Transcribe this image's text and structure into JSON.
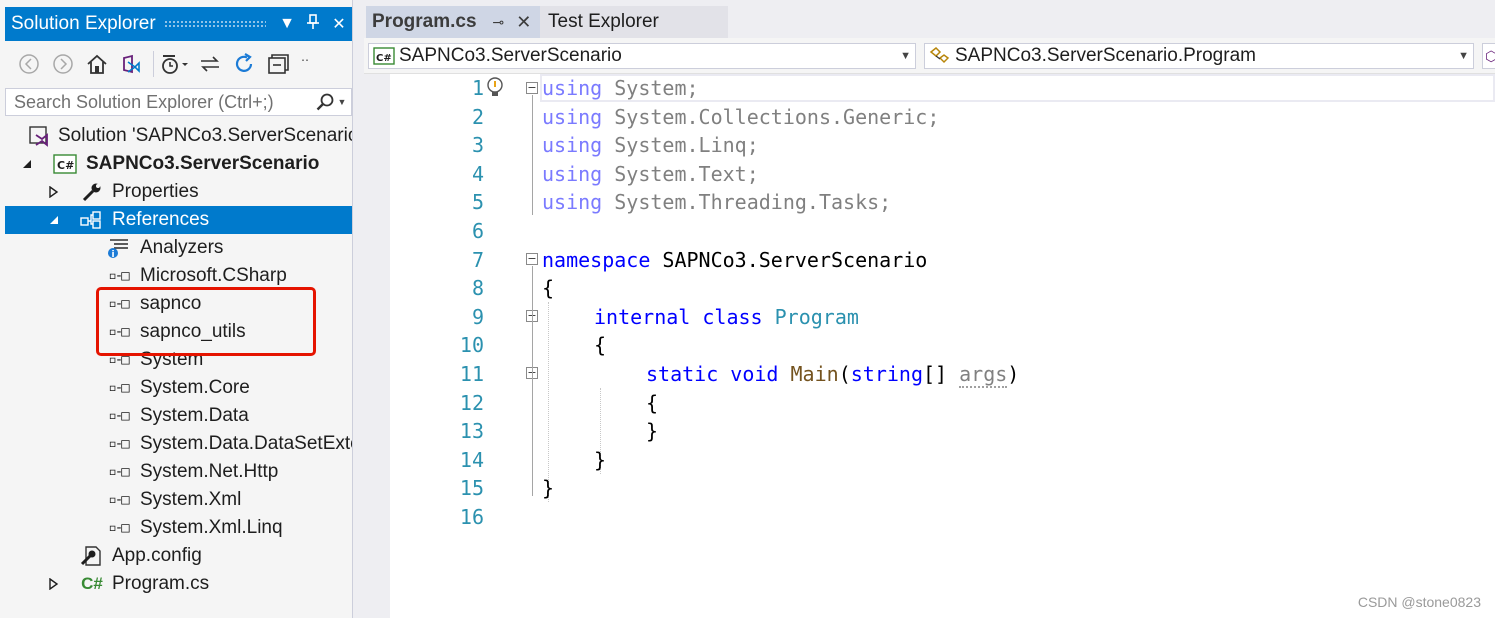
{
  "solution_explorer": {
    "title": "Solution Explorer",
    "search_placeholder": "Search Solution Explorer (Ctrl+;)",
    "tree": {
      "solution": "Solution 'SAPNCo3.ServerScenario",
      "project": "SAPNCo3.ServerScenario",
      "properties": "Properties",
      "references": "References",
      "ref_items": [
        "Analyzers",
        "Microsoft.CSharp",
        "sapnco",
        "sapnco_utils",
        "System",
        "System.Core",
        "System.Data",
        "System.Data.DataSetExte",
        "System.Net.Http",
        "System.Xml",
        "System.Xml.Linq"
      ],
      "app_config": "App.config",
      "program_cs": "Program.cs"
    }
  },
  "editor": {
    "tabs": [
      {
        "label": "Program.cs",
        "active": true
      },
      {
        "label": "Test Explorer",
        "active": false
      }
    ],
    "nav_project": "SAPNCo3.ServerScenario",
    "nav_class": "SAPNCo3.ServerScenario.Program",
    "line_numbers": [
      "1",
      "2",
      "3",
      "4",
      "5",
      "6",
      "7",
      "8",
      "9",
      "10",
      "11",
      "12",
      "13",
      "14",
      "15",
      "16"
    ],
    "code": {
      "l1_kw": "using",
      "l1_rest": " System;",
      "l2_kw": "using",
      "l2_rest": " System.Collections.Generic;",
      "l3_kw": "using",
      "l3_rest": " System.Linq;",
      "l4_kw": "using",
      "l4_rest": " System.Text;",
      "l5_kw": "using",
      "l5_rest": " System.Threading.Tasks;",
      "l7_kw": "namespace",
      "l7_rest": " SAPNCo3.ServerScenario",
      "l8": "{",
      "l9_kw1": "internal",
      "l9_kw2": "class",
      "l9_type": "Program",
      "l10": "{",
      "l11_kw1": "static",
      "l11_kw2": "void",
      "l11_meth": "Main",
      "l11_open": "(",
      "l11_kw3": "string",
      "l11_mid": "[] ",
      "l11_param": "args",
      "l11_close": ")",
      "l12": "{",
      "l13": "}",
      "l14": "}",
      "l15": "}"
    }
  },
  "watermark": "CSDN @stone0823",
  "colors": {
    "accent": "#007acc",
    "highlight_box": "#e51400",
    "keyword": "#0000ff",
    "type": "#2b91af",
    "line_number": "#2b91af"
  }
}
